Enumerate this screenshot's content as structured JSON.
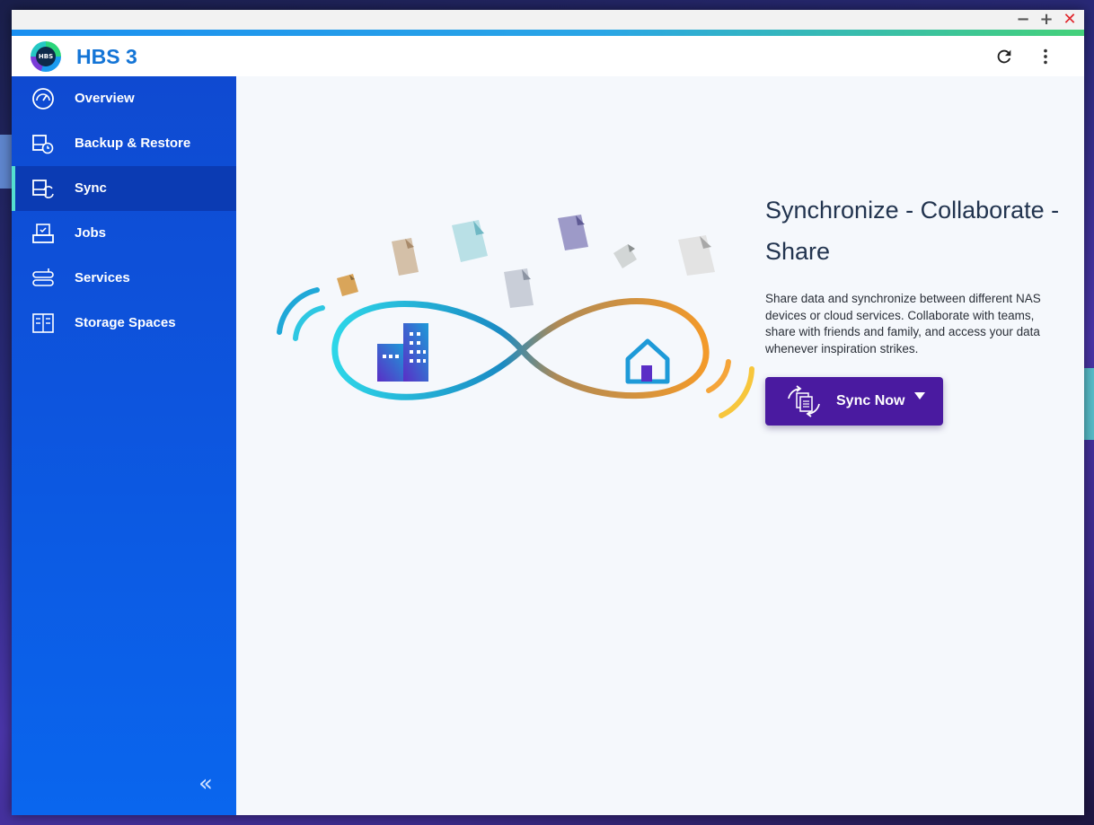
{
  "window": {
    "controls": {
      "minimize": "−",
      "maximize": "+",
      "close": "✕"
    }
  },
  "header": {
    "logo_text": "HBS",
    "title": "HBS 3",
    "actions": [
      "refresh-icon",
      "more-vert-icon"
    ]
  },
  "sidebar": {
    "items": [
      {
        "label": "Overview",
        "icon": "dashboard-gauge-icon",
        "active": false
      },
      {
        "label": "Backup & Restore",
        "icon": "backup-restore-icon",
        "active": false
      },
      {
        "label": "Sync",
        "icon": "sync-icon",
        "active": true
      },
      {
        "label": "Jobs",
        "icon": "jobs-icon",
        "active": false
      },
      {
        "label": "Services",
        "icon": "services-icon",
        "active": false
      },
      {
        "label": "Storage Spaces",
        "icon": "storage-spaces-icon",
        "active": false
      }
    ],
    "collapse_label": "«"
  },
  "main": {
    "headline": "Synchronize - Collaborate - Share",
    "description": "Share data and synchronize between different NAS devices or cloud services. Collaborate with teams, share with friends and family, and access your data whenever inspiration strikes.",
    "sync_button": {
      "label": "Sync Now",
      "icon": "sync-files-icon",
      "has_dropdown": true
    }
  },
  "colors": {
    "brand_blue": "#1475d6",
    "sidebar_active": "#0b3bb3",
    "active_indicator": "#54e0d0",
    "sync_button": "#4a1aa0"
  }
}
